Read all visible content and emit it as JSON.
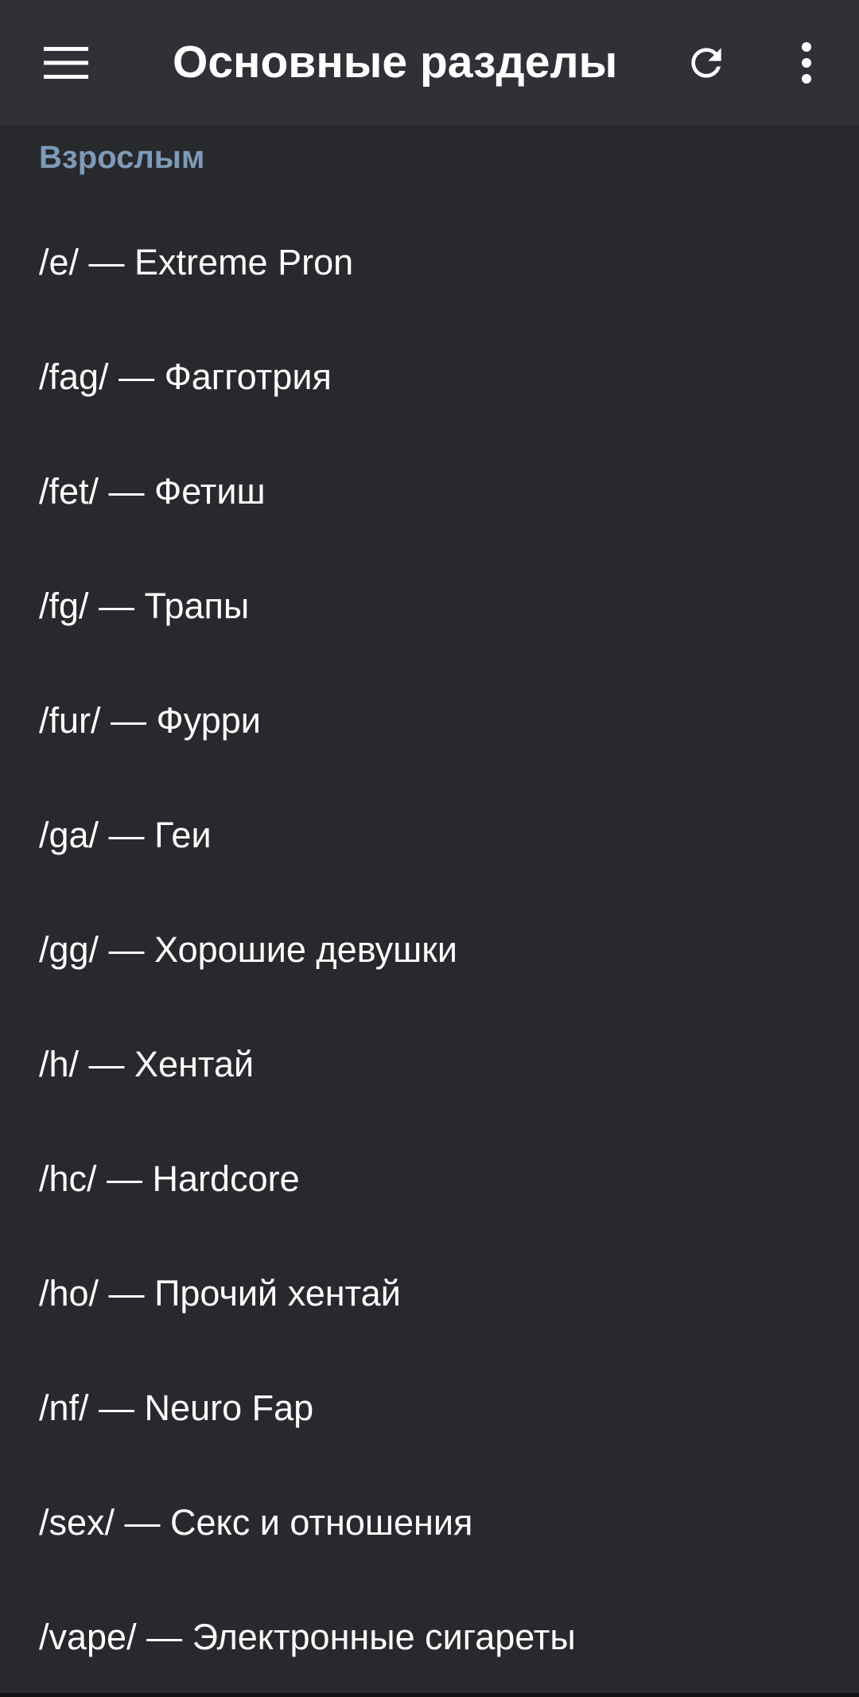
{
  "toolbar": {
    "title": "Основные разделы",
    "menu_icon": "hamburger-menu-icon",
    "refresh_icon": "refresh-icon",
    "more_icon": "more-vertical-icon"
  },
  "section": {
    "header": "Взрослым"
  },
  "boards": [
    {
      "label": "/e/ — Extreme Pron"
    },
    {
      "label": "/fag/ — Фагготрия"
    },
    {
      "label": "/fet/ — Фетиш"
    },
    {
      "label": "/fg/ — Трапы"
    },
    {
      "label": "/fur/ — Фурри"
    },
    {
      "label": "/ga/ — Геи"
    },
    {
      "label": "/gg/ — Хорошие девушки"
    },
    {
      "label": "/h/ — Хентай"
    },
    {
      "label": "/hc/ — Hardcore"
    },
    {
      "label": "/ho/ — Прочий хентай"
    },
    {
      "label": "/nf/ — Neuro Fap"
    },
    {
      "label": "/sex/ — Секс и отношения"
    },
    {
      "label": "/vape/ — Электронные сигареты"
    }
  ],
  "colors": {
    "background": "#28292d",
    "toolbar": "#303136",
    "section_header": "#7d9bb8",
    "text": "#ffffff"
  }
}
